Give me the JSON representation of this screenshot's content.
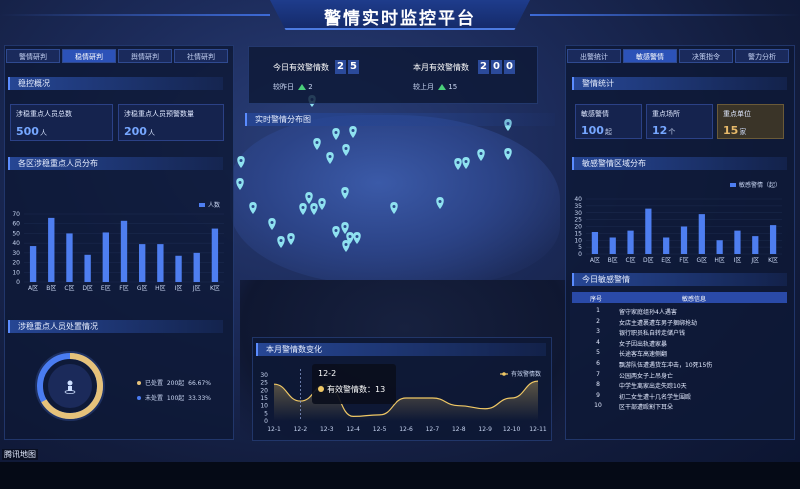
{
  "header": {
    "title": "警情实时监控平台"
  },
  "left_tabs": [
    "警情研判",
    "稳情研判",
    "舆情研判",
    "社情研判"
  ],
  "left_tab_active": 1,
  "right_tabs": [
    "出警统计",
    "敏感警情",
    "决策指令",
    "警力分析"
  ],
  "right_tab_active": 1,
  "stability": {
    "title": "稳控概况",
    "total_label": "涉稳重点人员总数",
    "total_value": "500",
    "total_unit": "人",
    "warn_label": "涉稳重点人员预警数量",
    "warn_value": "200",
    "warn_unit": "人"
  },
  "district_chart": {
    "title": "各区涉稳重点人员分布",
    "legend": "人数",
    "chart_data": {
      "type": "bar",
      "categories": [
        "A区",
        "B区",
        "C区",
        "D区",
        "E区",
        "F区",
        "G区",
        "H区",
        "I区",
        "J区",
        "K区"
      ],
      "values": [
        37,
        66,
        50,
        28,
        51,
        63,
        39,
        39,
        27,
        30,
        55
      ],
      "ylim": [
        0,
        70
      ],
      "yticks": [
        0,
        10,
        20,
        30,
        40,
        50,
        60,
        70
      ]
    }
  },
  "handling": {
    "title": "涉稳重点人员处置情况",
    "items": [
      {
        "label": "已处置",
        "count": "200起",
        "pct": "66.67%",
        "color": "#e6c27a"
      },
      {
        "label": "未处置",
        "count": "100起",
        "pct": "33.33%",
        "color": "#4a7cf0"
      }
    ],
    "done_fraction": 0.6667
  },
  "today": {
    "label": "今日有效警情数",
    "digits": [
      "2",
      "5"
    ],
    "compare_label": "较昨日",
    "compare_value": "2"
  },
  "month": {
    "label": "本月有效警情数",
    "digits": [
      "2",
      "0",
      "0"
    ],
    "compare_label": "较上月",
    "compare_value": "15"
  },
  "map": {
    "title": "实时警情分布图",
    "provider": "腾讯地图"
  },
  "trend": {
    "title": "本月警情数变化",
    "legend": "有效警情数",
    "tooltip": {
      "date": "12-2",
      "label": "有效警情数：13"
    },
    "chart_data": {
      "type": "line",
      "x": [
        "12-1",
        "12-2",
        "12-3",
        "12-4",
        "12-5",
        "12-6",
        "12-7",
        "12-8",
        "12-9",
        "12-10",
        "12-11"
      ],
      "values": [
        24,
        13,
        24,
        3,
        4,
        15,
        15,
        10,
        8,
        15,
        26
      ],
      "ylim": [
        0,
        30
      ],
      "yticks": [
        0,
        5,
        10,
        15,
        20,
        25,
        30
      ]
    }
  },
  "alert_stats": {
    "title": "警情统计",
    "cards": [
      {
        "label": "敏感警情",
        "value": "100",
        "unit": "起"
      },
      {
        "label": "重点场所",
        "value": "12",
        "unit": "个"
      },
      {
        "label": "重点单位",
        "value": "15",
        "unit": "家"
      }
    ]
  },
  "sensitive_chart": {
    "title": "敏感警情区域分布",
    "legend": "敏感警情（起）",
    "chart_data": {
      "type": "bar",
      "categories": [
        "A区",
        "B区",
        "C区",
        "D区",
        "E区",
        "F区",
        "G区",
        "H区",
        "I区",
        "J区",
        "K区"
      ],
      "values": [
        16,
        12,
        17,
        33,
        12,
        20,
        29,
        10,
        17,
        13,
        21
      ],
      "ylim": [
        0,
        40
      ],
      "yticks": [
        0,
        5,
        10,
        15,
        20,
        25,
        30,
        35,
        40
      ]
    }
  },
  "today_alerts": {
    "title": "今日敏感警情",
    "headers": [
      "序号",
      "敏感信息"
    ],
    "rows": [
      {
        "no": "1",
        "info": "留守家庭组孙4人遇害"
      },
      {
        "no": "2",
        "info": "女店主遭裹遭车男子捆绑抢劫"
      },
      {
        "no": "3",
        "info": "银行职员私自转走储户钱"
      },
      {
        "no": "4",
        "info": "女子因出轨遭家暴"
      },
      {
        "no": "5",
        "info": "长途客车高速侧翻"
      },
      {
        "no": "6",
        "info": "飘游队伍遭遇货车冲击，10死15伤"
      },
      {
        "no": "7",
        "info": "公园两女子上吊身亡"
      },
      {
        "no": "8",
        "info": "中学生离家出走失踪10天"
      },
      {
        "no": "9",
        "info": "初二女生遭十几名学生围殴"
      },
      {
        "no": "10",
        "info": "区干部遭殴割下耳朵"
      }
    ]
  }
}
